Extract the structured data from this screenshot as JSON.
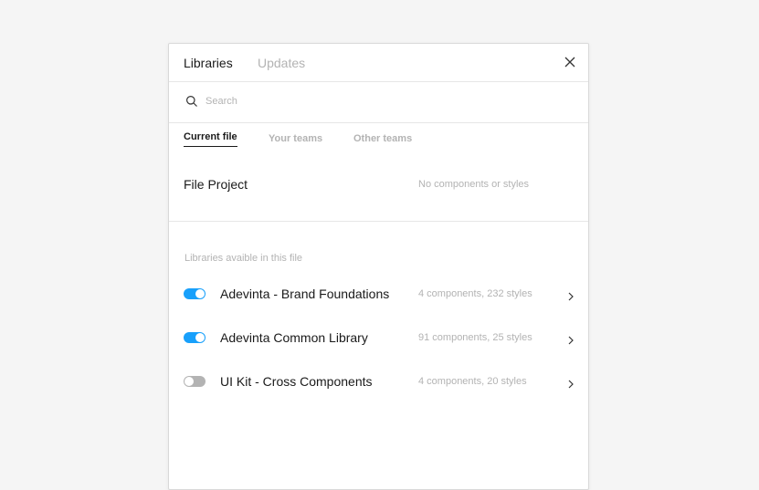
{
  "header": {
    "tabs": [
      {
        "label": "Libraries",
        "active": true
      },
      {
        "label": "Updates",
        "active": false
      }
    ]
  },
  "search": {
    "placeholder": "Search",
    "value": ""
  },
  "subtabs": [
    {
      "label": "Current file",
      "active": true
    },
    {
      "label": "Your teams",
      "active": false
    },
    {
      "label": "Other teams",
      "active": false
    }
  ],
  "current_file": {
    "name": "File Project",
    "meta": "No components or styles"
  },
  "libraries_section": {
    "label": "Libraries avaible in this file",
    "items": [
      {
        "name": "Adevinta - Brand Foundations",
        "meta": "4 components, 232 styles",
        "enabled": true
      },
      {
        "name": "Adevinta Common Library",
        "meta": "91 components, 25 styles",
        "enabled": true
      },
      {
        "name": "UI Kit - Cross Components",
        "meta": "4 components, 20 styles",
        "enabled": false
      }
    ]
  },
  "colors": {
    "accent": "#18a0fb",
    "toggle_off": "#b3b3b3",
    "text_primary": "#1a1a1a",
    "text_muted": "#b3b3b3"
  },
  "icons": {
    "close": "close-icon",
    "search": "search-icon",
    "chevron": "chevron-right-icon"
  }
}
